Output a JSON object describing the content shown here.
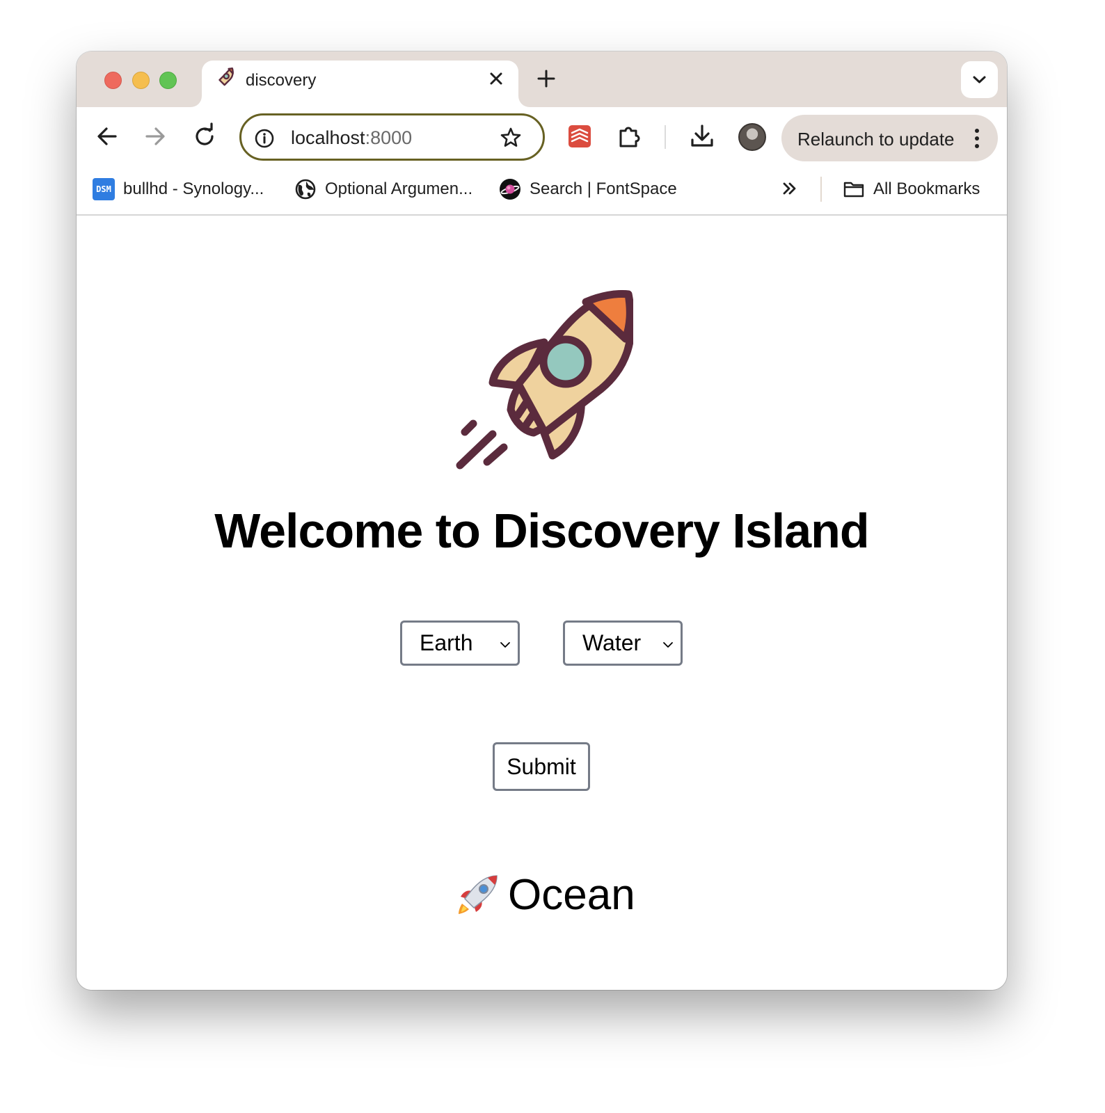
{
  "tab": {
    "title": "discovery"
  },
  "toolbar": {
    "url_host": "localhost",
    "url_port": ":8000",
    "relaunch_label": "Relaunch to update"
  },
  "bookmarks": {
    "items": [
      {
        "label": "bullhd - Synology...",
        "icon": "dsm-icon",
        "icon_text": "DSM"
      },
      {
        "label": "Optional Argumen...",
        "icon": "globe-icon"
      },
      {
        "label": "Search | FontSpace",
        "icon": "fontspace-icon"
      }
    ],
    "all_bookmarks_label": "All Bookmarks"
  },
  "page": {
    "headline": "Welcome to Discovery Island",
    "select_1": {
      "selected": "Earth"
    },
    "select_2": {
      "selected": "Water"
    },
    "submit_label": "Submit",
    "result_text": "Ocean"
  },
  "colors": {
    "tabstrip": "#e4dcd7",
    "omnibox_border": "#676123",
    "select_border": "#757b87",
    "rocket_outline": "#5b2b3d",
    "rocket_body": "#efd29e",
    "rocket_nose": "#ee7e3e",
    "rocket_window": "#94c8be"
  }
}
